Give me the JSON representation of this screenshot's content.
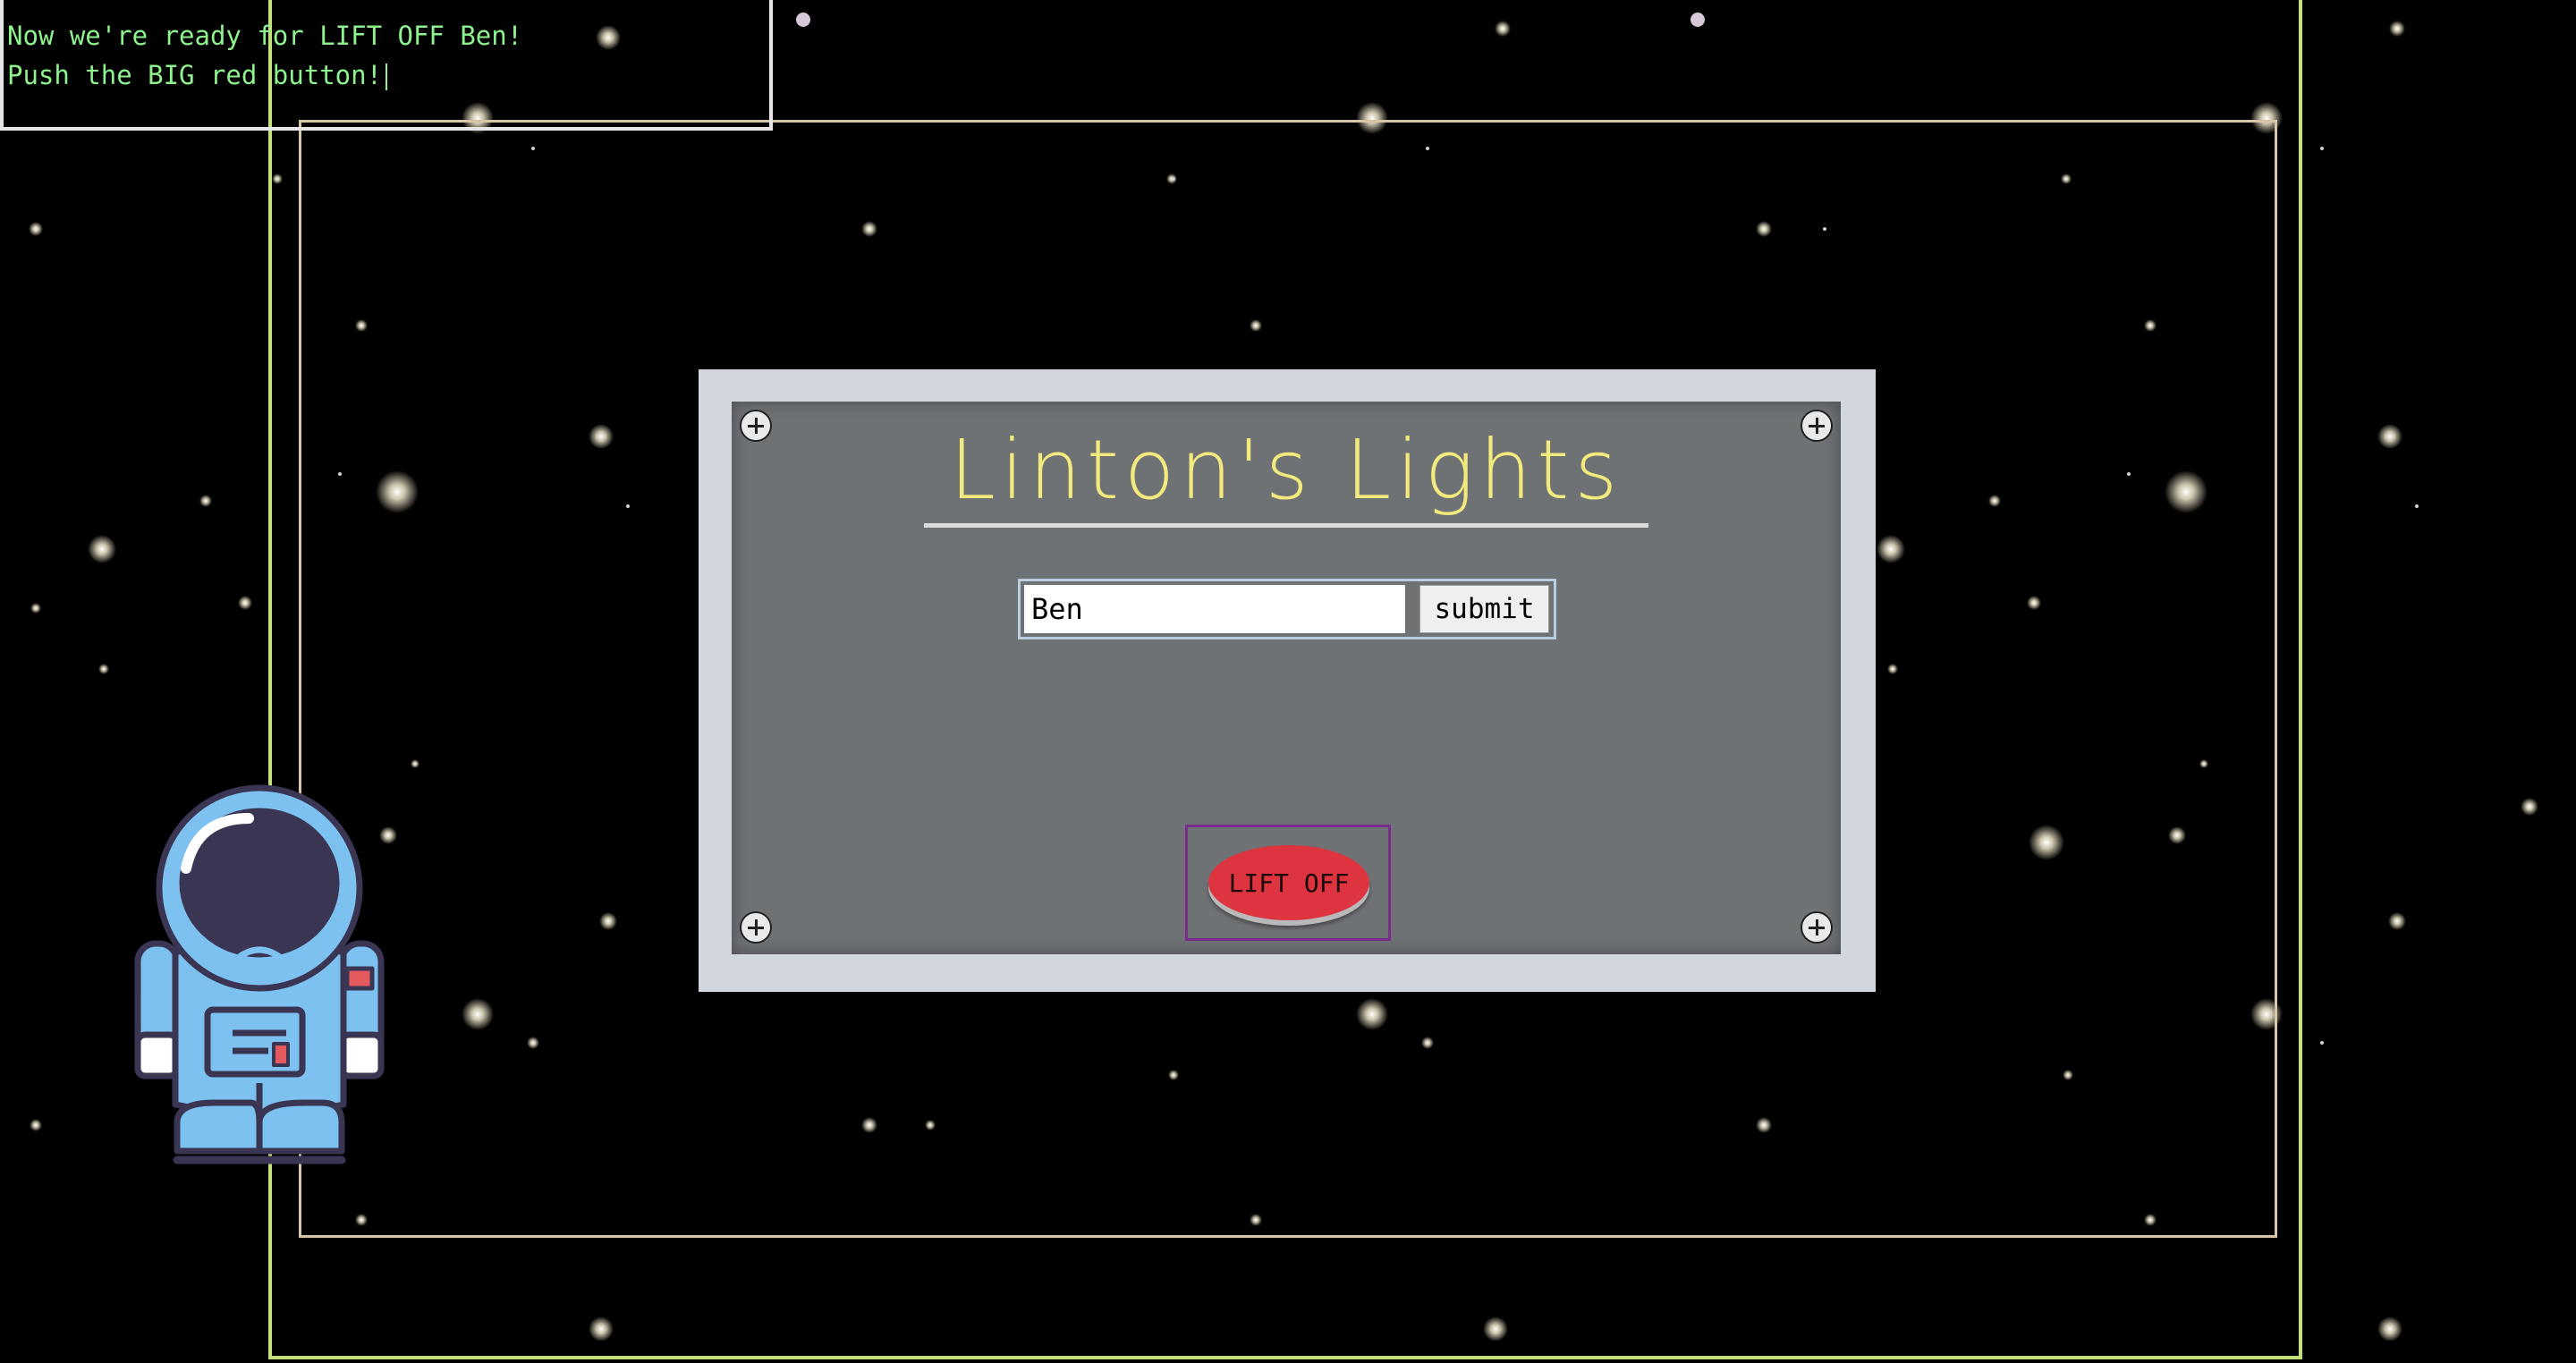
{
  "console": {
    "line1": "Now we're ready for LIFT OFF Ben!",
    "line2": "Push the BIG red button!"
  },
  "panel": {
    "title": "Linton's Lights",
    "name_input_value": "Ben",
    "submit_label": "submit",
    "liftoff_label": "LIFT OFF"
  },
  "colors": {
    "background": "#000000",
    "console_text": "#8ef28e",
    "title": "#f2ea7c",
    "panel_inner": "#6f7275",
    "panel_outer": "#d2d7df",
    "liftoff_button": "#de3440",
    "frame_green": "#c4e07a",
    "frame_tan": "#d8c6a8"
  },
  "icons": {
    "screw": "screw-icon",
    "mascot": "astronaut-icon"
  }
}
